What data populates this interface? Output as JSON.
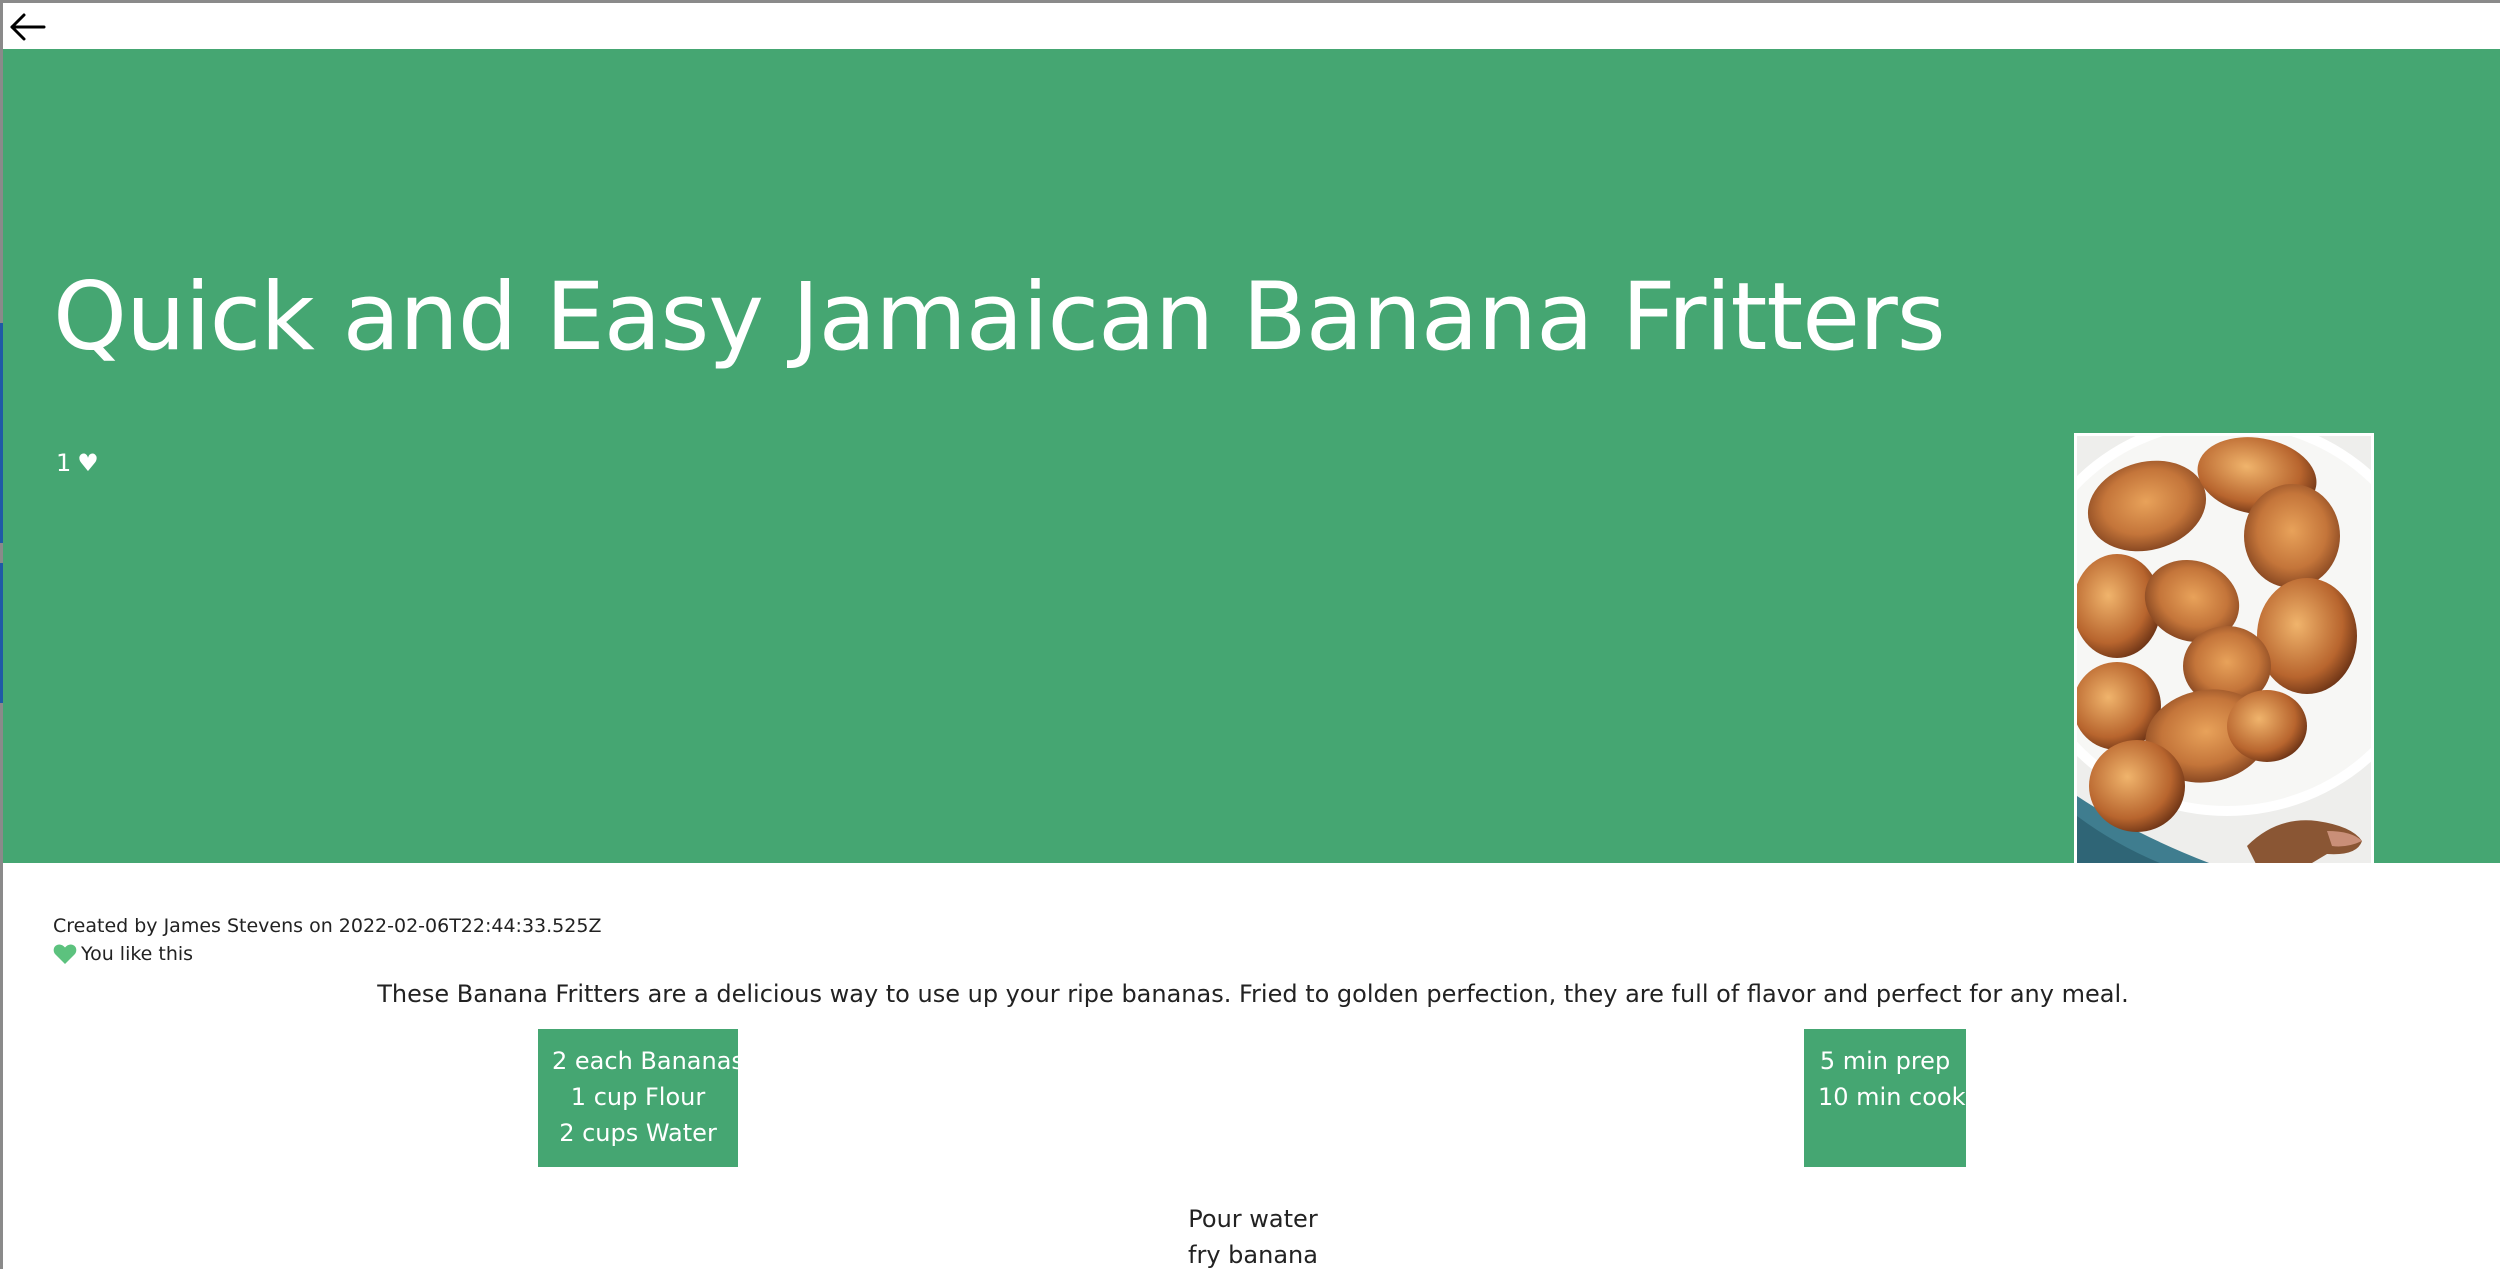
{
  "header": {
    "back_icon": "arrow-left-icon"
  },
  "recipe": {
    "title": "Quick and Easy Jamaican Banana Fritters",
    "likes_count": "1",
    "likes_heart": "♥",
    "image_icon": "banana-fritters-photo",
    "created_by": "Created by James Stevens on 2022-02-06T22:44:33.525Z",
    "like_status": "You like this",
    "description": "These Banana Fritters are a delicious way to use up your ripe bananas. Fried to golden perfection, they are full of flavor and perfect for any meal.",
    "ingredients": [
      "2 each Bananas",
      "1 cup Flour",
      "2 cups Water"
    ],
    "times": [
      "5 min prep",
      "10 min cook"
    ],
    "steps": [
      "Pour water",
      "fry banana"
    ]
  },
  "colors": {
    "hero_background": "#45a672",
    "card_background": "#45a672",
    "heart_green": "#5cc27e",
    "window_edge_blue": "#1f5aa6"
  }
}
